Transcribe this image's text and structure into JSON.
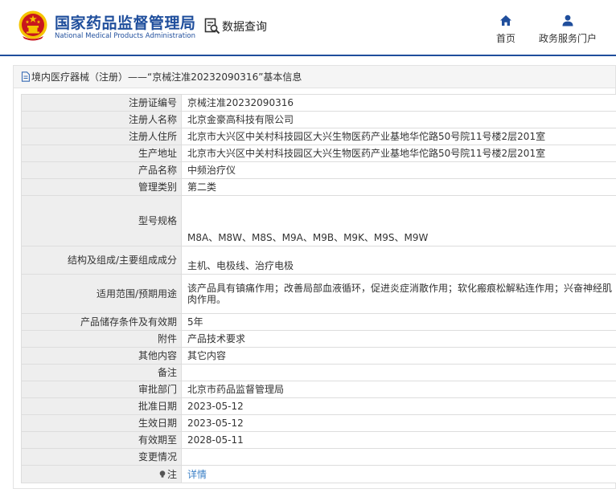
{
  "header": {
    "site_title": "国家药品监督管理局",
    "site_subtitle": "National Medical Products Administration",
    "query_label": "数据查询",
    "nav": {
      "home_label": "首页",
      "service_label": "政务服务门户"
    }
  },
  "panel": {
    "title": "境内医疗器械（注册）——“京械注准20232090316”基本信息"
  },
  "fields": [
    {
      "label": "注册证编号",
      "value": "京械注准20232090316"
    },
    {
      "label": "注册人名称",
      "value": "北京金豪高科技有限公司"
    },
    {
      "label": "注册人住所",
      "value": "北京市大兴区中关村科技园区大兴生物医药产业基地华佗路50号院11号楼2层201室"
    },
    {
      "label": "生产地址",
      "value": "北京市大兴区中关村科技园区大兴生物医药产业基地华佗路50号院11号楼2层201室"
    },
    {
      "label": "产品名称",
      "value": "中频治疗仪"
    },
    {
      "label": "管理类别",
      "value": "第二类"
    },
    {
      "label": "型号规格",
      "value": "M8A、M8W、M8S、M9A、M9B、M9K、M9S、M9W"
    },
    {
      "label": "结构及组成/主要组成成分",
      "value": "主机、电极线、治疗电极"
    },
    {
      "label": "适用范围/预期用途",
      "value": "该产品具有镇痛作用；改善局部血液循环，促进炎症消散作用；软化瘢痕松解粘连作用；兴奋神经肌肉作用。"
    },
    {
      "label": "产品储存条件及有效期",
      "value": "5年"
    },
    {
      "label": "附件",
      "value": "产品技术要求"
    },
    {
      "label": "其他内容",
      "value": "其它内容"
    },
    {
      "label": "备注",
      "value": ""
    },
    {
      "label": "审批部门",
      "value": "北京市药品监督管理局"
    },
    {
      "label": "批准日期",
      "value": "2023-05-12"
    },
    {
      "label": "生效日期",
      "value": "2023-05-12"
    },
    {
      "label": "有效期至",
      "value": "2028-05-11"
    },
    {
      "label": "变更情况",
      "value": ""
    },
    {
      "label": "注",
      "value": "详情"
    }
  ],
  "colors": {
    "brand_blue": "#1f4e9c",
    "link_blue": "#3a7fc6",
    "emblem_red": "#c8161d",
    "emblem_gold": "#f5c400"
  },
  "icons": {
    "emblem": "national-emblem-icon",
    "query": "search-document-icon",
    "home": "home-icon",
    "service": "user-icon",
    "panel_head": "document-icon",
    "note": "lightbulb-icon"
  }
}
